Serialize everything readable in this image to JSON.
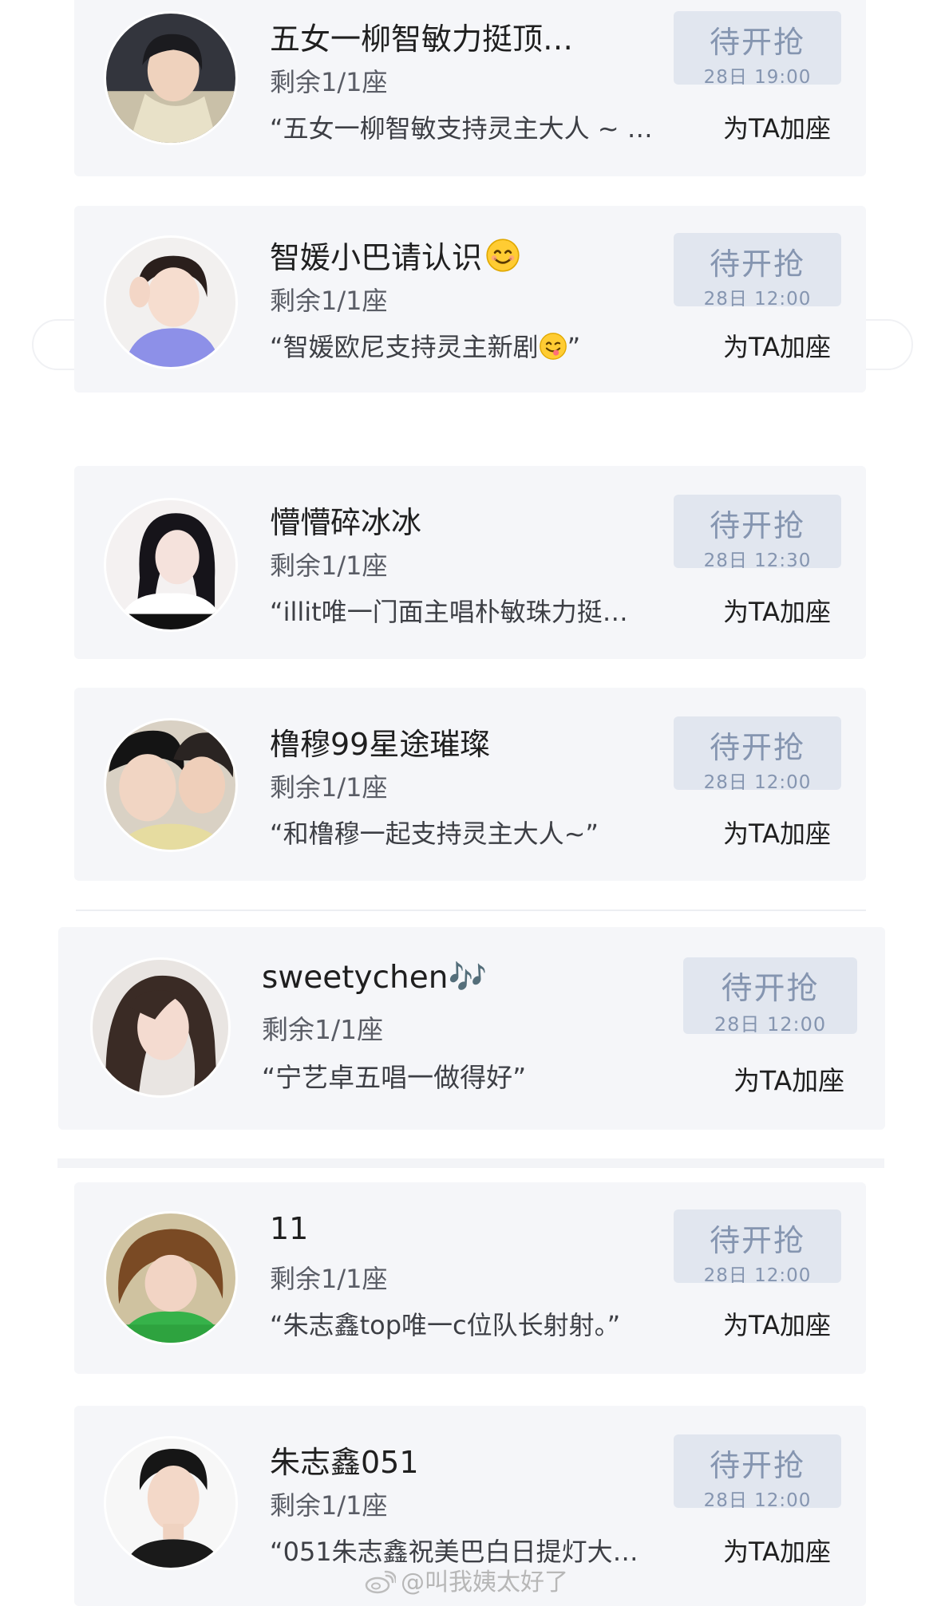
{
  "cards": [
    {
      "name": "五女一柳智敏力挺顶…",
      "seats": "剩余1/1座",
      "message": "“五女一柳智敏支持灵主大人 ~ …",
      "grab_label": "待开抢",
      "grab_time": "28日 19:00",
      "add_label": "为TA加座"
    },
    {
      "name": "智媛小巴请认识",
      "seats": "剩余1/1座",
      "message_before": "“智媛欧尼支持灵主新剧",
      "message_after": "”",
      "grab_label": "待开抢",
      "grab_time": "28日 12:00",
      "add_label": "为TA加座"
    },
    {
      "name": "懵懵碎冰冰",
      "seats": "剩余1/1座",
      "message": "“illit唯一门面主唱朴敏珠力挺…",
      "grab_label": "待开抢",
      "grab_time": "28日 12:30",
      "add_label": "为TA加座"
    },
    {
      "name": "橹穆99星途璀璨",
      "seats": "剩余1/1座",
      "message": "“和橹穆一起支持灵主大人~”",
      "grab_label": "待开抢",
      "grab_time": "28日 12:00",
      "add_label": "为TA加座"
    },
    {
      "name": "sweetychen🎶",
      "seats": "剩余1/1座",
      "message": "“宁艺卓五唱一做得好”",
      "grab_label": "待开抢",
      "grab_time": "28日 12:00",
      "add_label": "为TA加座"
    },
    {
      "name": "11",
      "seats": "剩余1/1座",
      "message": "“朱志鑫top唯一c位队长射射。”",
      "grab_label": "待开抢",
      "grab_time": "28日 12:00",
      "add_label": "为TA加座"
    },
    {
      "name": "朱志鑫051",
      "seats": "剩余1/1座",
      "message": "“051朱志鑫祝美巴白日提灯大…",
      "grab_label": "待开抢",
      "grab_time": "28日 12:00",
      "add_label": "为TA加座"
    }
  ],
  "watermark": "@叫我姨太好了",
  "colors": {
    "card_background": "#f5f6f9",
    "grab_button_background": "#e1e6ef",
    "grab_button_text": "#8595b0"
  },
  "icons": {
    "smile_emoji": "smiling-face-emoji",
    "yum_emoji": "face-savoring-food-emoji",
    "weibo_logo": "weibo-logo-icon"
  }
}
